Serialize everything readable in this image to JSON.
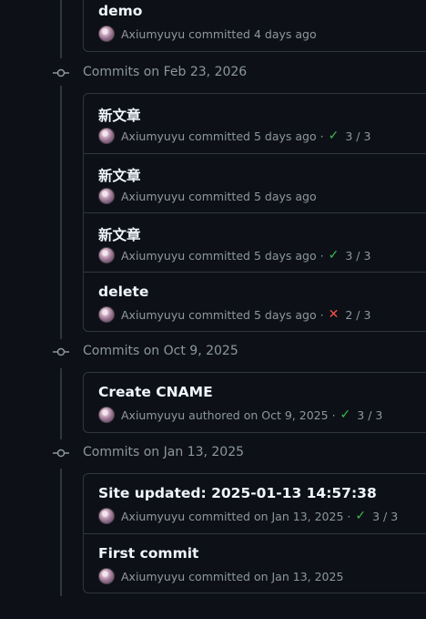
{
  "groups": [
    {
      "header": "",
      "commits": [
        {
          "title": "demo",
          "author": "Axiumyuyu",
          "verb": "committed",
          "time": "4 days ago",
          "status": "",
          "checks": ""
        }
      ]
    },
    {
      "header": "Commits on Feb 23, 2026",
      "commits": [
        {
          "title": "新文章",
          "author": "Axiumyuyu",
          "verb": "committed",
          "time": "5 days ago",
          "status": "success",
          "checks": "3 / 3"
        },
        {
          "title": "新文章",
          "author": "Axiumyuyu",
          "verb": "committed",
          "time": "5 days ago",
          "status": "",
          "checks": ""
        },
        {
          "title": "新文章",
          "author": "Axiumyuyu",
          "verb": "committed",
          "time": "5 days ago",
          "status": "success",
          "checks": "3 / 3"
        },
        {
          "title": "delete",
          "author": "Axiumyuyu",
          "verb": "committed",
          "time": "5 days ago",
          "status": "failure",
          "checks": "2 / 3"
        }
      ]
    },
    {
      "header": "Commits on Oct 9, 2025",
      "commits": [
        {
          "title": "Create CNAME",
          "author": "Axiumyuyu",
          "verb": "authored",
          "time": "on Oct 9, 2025",
          "status": "success",
          "checks": "3 / 3"
        }
      ]
    },
    {
      "header": "Commits on Jan 13, 2025",
      "commits": [
        {
          "title": "Site updated: 2025-01-13 14:57:38",
          "author": "Axiumyuyu",
          "verb": "committed",
          "time": "on Jan 13, 2025",
          "status": "success",
          "checks": "3 / 3"
        },
        {
          "title": "First commit",
          "author": "Axiumyuyu",
          "verb": "committed",
          "time": "on Jan 13, 2025",
          "status": "",
          "checks": ""
        }
      ]
    }
  ],
  "colors": {
    "background": "#0d1117",
    "border": "#30363d",
    "success": "#3fb950",
    "failure": "#f85149",
    "muted": "#8d96a0"
  },
  "icons": {
    "commit_node": "git-commit-icon",
    "success": "check-icon",
    "failure": "x-icon"
  }
}
